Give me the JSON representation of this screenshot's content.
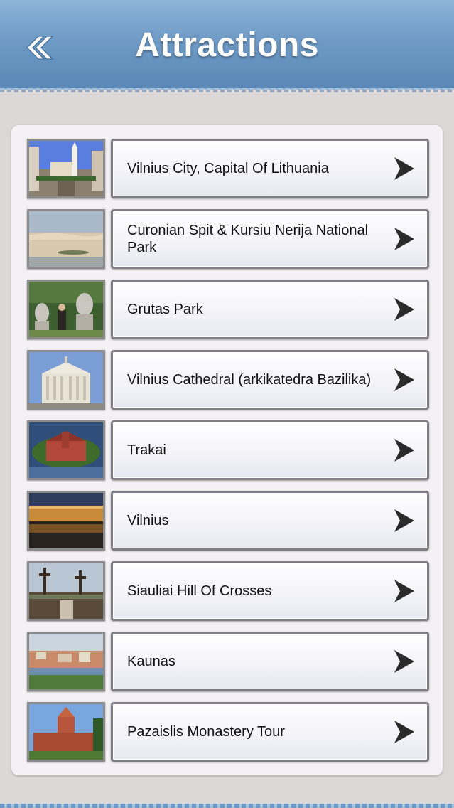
{
  "header": {
    "title": "Attractions",
    "back_icon": "double-chevron-left-icon"
  },
  "colors": {
    "header_top": "#8eb5d9",
    "header_bottom": "#5a87b6",
    "background": "#dcd8d8",
    "panel": "#f3f1f3"
  },
  "attractions": [
    {
      "label": "Vilnius City, Capital Of Lithuania",
      "thumb": "vilnius-street-photo"
    },
    {
      "label": "Curonian Spit & Kursiu Nerija National Park",
      "thumb": "sand-dunes-photo"
    },
    {
      "label": "Grutas Park",
      "thumb": "statues-park-photo"
    },
    {
      "label": "Vilnius Cathedral (arkikatedra Bazilika)",
      "thumb": "cathedral-photo"
    },
    {
      "label": "Trakai",
      "thumb": "island-castle-photo"
    },
    {
      "label": "Vilnius",
      "thumb": "night-city-photo"
    },
    {
      "label": "Siauliai Hill Of Crosses",
      "thumb": "hill-of-crosses-photo"
    },
    {
      "label": "Kaunas",
      "thumb": "kaunas-city-photo"
    },
    {
      "label": "Pazaislis Monastery Tour",
      "thumb": "brick-castle-photo"
    }
  ]
}
